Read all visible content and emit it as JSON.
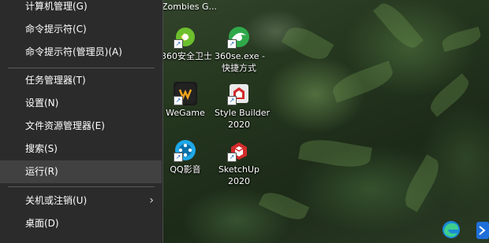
{
  "menu": {
    "items": [
      {
        "label": "计算机管理(G)"
      },
      {
        "label": "命令提示符(C)"
      },
      {
        "label": "命令提示符(管理员)(A)"
      },
      {
        "label": "任务管理器(T)"
      },
      {
        "label": "设置(N)"
      },
      {
        "label": "文件资源管理器(E)"
      },
      {
        "label": "搜索(S)"
      },
      {
        "label": "运行(R)"
      },
      {
        "label": "关机或注销(U)"
      },
      {
        "label": "桌面(D)"
      }
    ],
    "submenu_icon": "chevron-right-icon"
  },
  "desktop": {
    "partial_title": "Zombies G...",
    "icons": [
      {
        "label": "360安全卫士",
        "icon": "360-safe-icon"
      },
      {
        "label": "360se.exe -",
        "label2": "快捷方式",
        "icon": "360se-icon"
      },
      {
        "label": "WeGame",
        "icon": "wegame-icon"
      },
      {
        "label": "Style Builder",
        "label2": "2020",
        "icon": "sketchup-style-builder-icon"
      },
      {
        "label": "QQ影音",
        "icon": "qq-player-icon"
      },
      {
        "label": "SketchUp",
        "label2": "2020",
        "icon": "sketchup-icon"
      }
    ]
  },
  "taskbar": {
    "icons": [
      "edge-icon",
      "blue-app-icon"
    ]
  },
  "colors": {
    "menu_bg": "#2b2b2b",
    "menu_highlight": "#414141",
    "menu_text": "#ffffff"
  }
}
